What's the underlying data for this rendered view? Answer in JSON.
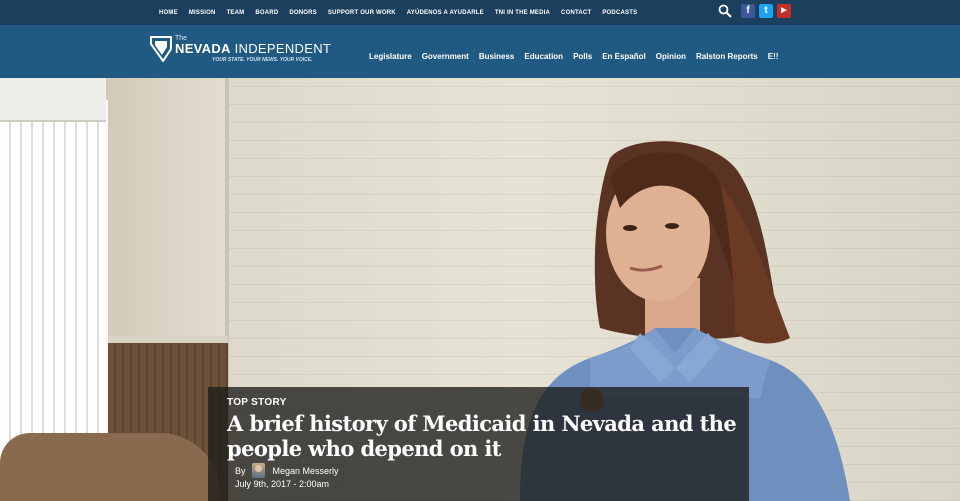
{
  "topnav": {
    "items": [
      "HOME",
      "MISSION",
      "TEAM",
      "BOARD",
      "DONORS",
      "SUPPORT OUR WORK",
      "AYÚDENOS A AYUDARLE",
      "TNI IN THE MEDIA",
      "CONTACT",
      "PODCASTS"
    ]
  },
  "social": {
    "facebook": "f",
    "twitter": "t",
    "youtube": "▶"
  },
  "logo": {
    "the": "The",
    "name_bold": "NEVADA",
    "name_light": " INDEPENDENT",
    "tagline": "YOUR STATE. YOUR NEWS. YOUR VOICE."
  },
  "mainnav": {
    "items": [
      "Legislature",
      "Government",
      "Business",
      "Education",
      "Polls",
      "En Español",
      "Opinion",
      "Ralston Reports",
      "E!!"
    ]
  },
  "story": {
    "kicker": "TOP STORY",
    "headline": "A brief history of Medicaid in Nevada and the people who depend on it",
    "by": "By",
    "author": "Megan Messerly",
    "date": "July 9th, 2017 - 2:00am"
  },
  "colors": {
    "topbar": "#1c3f5e",
    "header": "#205a82",
    "facebook": "#3b5998",
    "twitter": "#1da1f2",
    "youtube": "#c4302b"
  },
  "icons": [
    "search-icon",
    "facebook-icon",
    "twitter-icon",
    "youtube-icon",
    "nevada-logo-icon"
  ]
}
